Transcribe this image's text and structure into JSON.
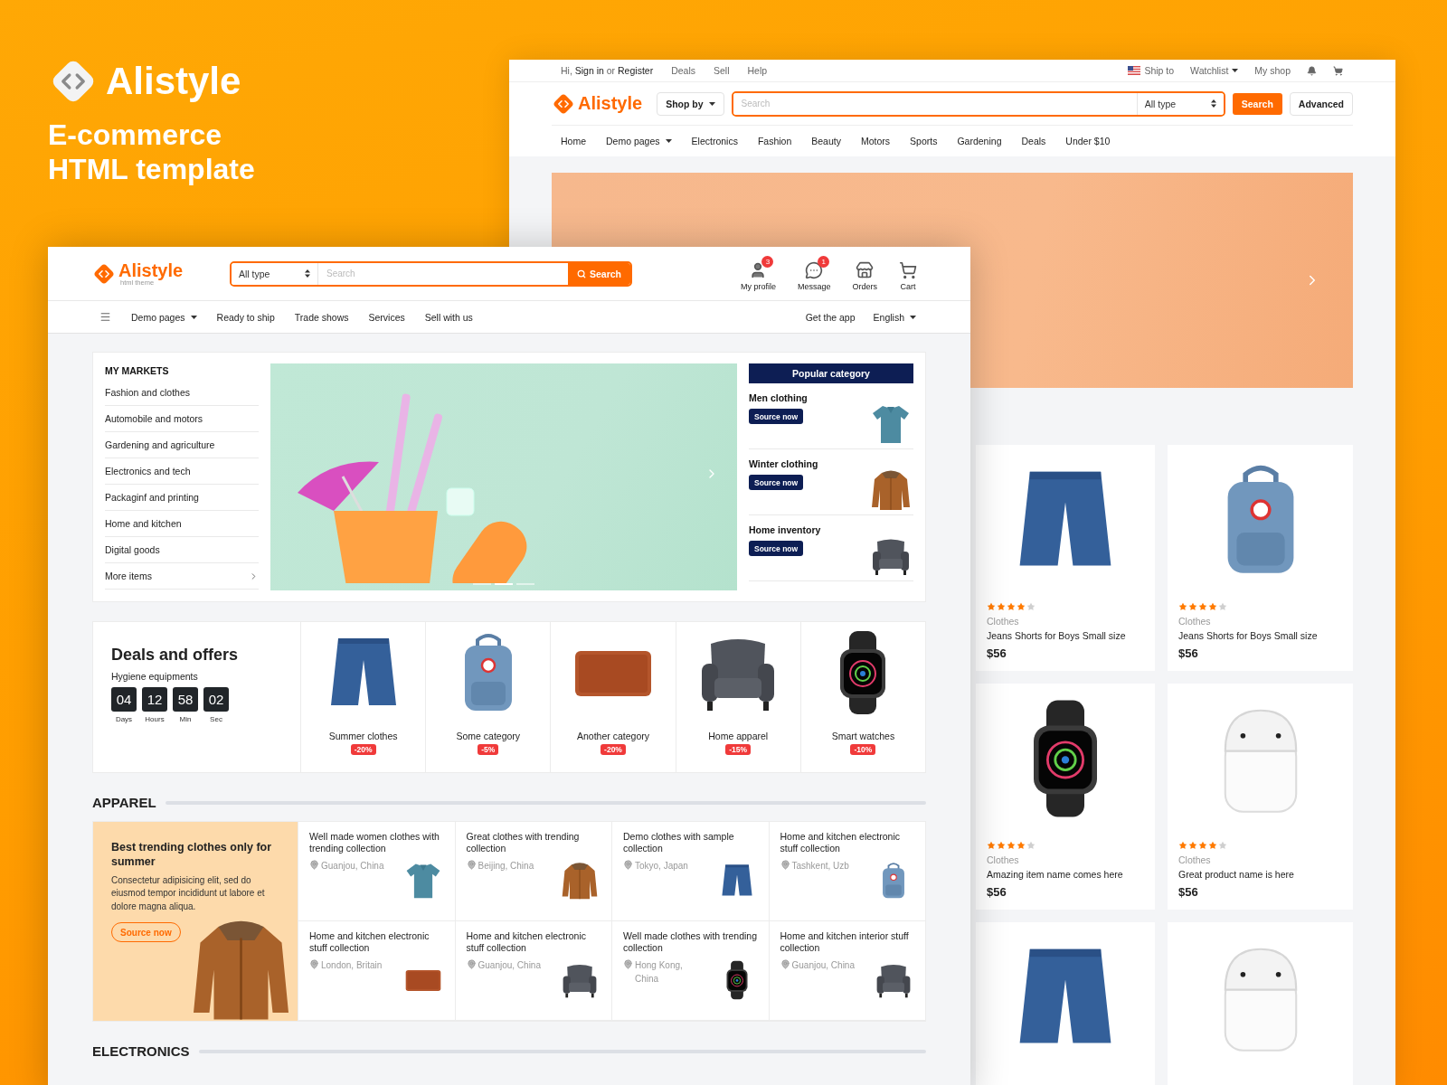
{
  "promo": {
    "brand": "Alistyle",
    "headline": "E-commerce HTML template"
  },
  "back_window": {
    "top_bar": {
      "greeting": "Hi, **Sign in** or **Register**",
      "links": [
        "Deals",
        "Sell",
        "Help"
      ],
      "ship_to": "Ship to",
      "watchlist": "Watchlist",
      "my_shop": "My shop"
    },
    "header": {
      "brand": "Alistyle",
      "shop_by": "Shop by",
      "search": {
        "placeholder": "Search"
      },
      "type_select": "All type",
      "search_button": "Search",
      "advanced_button": "Advanced"
    },
    "nav": [
      {
        "label": "Home",
        "dropdown": false
      },
      {
        "label": "Demo pages",
        "dropdown": true
      },
      {
        "label": "Electronics",
        "dropdown": false
      },
      {
        "label": "Fashion",
        "dropdown": false
      },
      {
        "label": "Beauty",
        "dropdown": false
      },
      {
        "label": "Motors",
        "dropdown": false
      },
      {
        "label": "Sports",
        "dropdown": false
      },
      {
        "label": "Gardening",
        "dropdown": false
      },
      {
        "label": "Deals",
        "dropdown": false
      },
      {
        "label": "Under $10",
        "dropdown": false
      }
    ],
    "products": [
      {
        "kind": "shorts",
        "stars": 4,
        "category": "Clothes",
        "name": "Jeans Shorts for Boys Small size",
        "price": "$56"
      },
      {
        "kind": "backpack",
        "stars": 4,
        "category": "Clothes",
        "name": "Jeans Shorts for Boys Small size",
        "price": "$56"
      },
      {
        "kind": "watch",
        "stars": 4,
        "category": "Clothes",
        "name": "Amazing item name comes here",
        "price": "$56"
      },
      {
        "kind": "airpods",
        "stars": 4,
        "category": "Clothes",
        "name": "Great product name is here",
        "price": "$56"
      },
      {
        "kind": "shorts"
      },
      {
        "kind": "airpods"
      }
    ]
  },
  "front_window": {
    "header": {
      "brand": "Alistyle",
      "tagline": "html theme",
      "type_select": "All type",
      "search": {
        "placeholder": "Search"
      },
      "search_button": "Search",
      "actions": [
        {
          "kind": "profile",
          "label": "My profile",
          "badge": "3"
        },
        {
          "kind": "message",
          "label": "Message",
          "badge": "1"
        },
        {
          "kind": "orders",
          "label": "Orders"
        },
        {
          "kind": "cart",
          "label": "Cart"
        }
      ]
    },
    "nav": {
      "left": [
        {
          "label": "Demo pages",
          "dropdown": true
        },
        {
          "label": "Ready to ship",
          "dropdown": false
        },
        {
          "label": "Trade shows",
          "dropdown": false
        },
        {
          "label": "Services",
          "dropdown": false
        },
        {
          "label": "Sell with us",
          "dropdown": false
        }
      ],
      "right": [
        {
          "label": "Get the app",
          "dropdown": false
        },
        {
          "label": "English",
          "dropdown": true
        }
      ]
    },
    "markets": {
      "title": "MY MARKETS",
      "items": [
        {
          "label": "Fashion and clothes",
          "chevron": false
        },
        {
          "label": "Automobile and motors",
          "chevron": false
        },
        {
          "label": "Gardening and agriculture",
          "chevron": false
        },
        {
          "label": "Electronics and tech",
          "chevron": false
        },
        {
          "label": "Packaginf and printing",
          "chevron": false
        },
        {
          "label": "Home and kitchen",
          "chevron": false
        },
        {
          "label": "Digital goods",
          "chevron": false
        },
        {
          "label": "More items",
          "chevron": true
        }
      ]
    },
    "banner": {
      "slides": [
        {
          "selected": false
        },
        {
          "selected": true
        },
        {
          "selected": false
        }
      ]
    },
    "popular": {
      "title": "Popular category",
      "items": [
        {
          "kind": "polo",
          "name": "Men clothing",
          "button": "Source now"
        },
        {
          "kind": "jacket",
          "name": "Winter clothing",
          "button": "Source now"
        },
        {
          "kind": "armchair",
          "name": "Home inventory",
          "button": "Source now"
        }
      ]
    },
    "deals": {
      "title": "Deals and offers",
      "subtitle": "Hygiene equipments",
      "countdown": [
        {
          "value": "04",
          "unit": "Days"
        },
        {
          "value": "12",
          "unit": "Hours"
        },
        {
          "value": "58",
          "unit": "Min"
        },
        {
          "value": "02",
          "unit": "Sec"
        }
      ],
      "items": [
        {
          "kind": "shorts",
          "name": "Summer clothes",
          "discount": "-20%"
        },
        {
          "kind": "backpack",
          "name": "Some category",
          "discount": "-5%"
        },
        {
          "kind": "sleeve",
          "name": "Another category",
          "discount": "-20%"
        },
        {
          "kind": "armchair",
          "name": "Home apparel",
          "discount": "-15%"
        },
        {
          "kind": "watch",
          "name": "Smart watches",
          "discount": "-10%"
        }
      ]
    },
    "apparel": {
      "title": "APPAREL",
      "promo": {
        "title": "Best trending clothes only for summer",
        "text": "Consectetur adipisicing elit, sed do eiusmod tempor incididunt ut labore et dolore magna aliqua.",
        "button": "Source now"
      },
      "items": [
        {
          "kind": "polo",
          "name": "Well made women clothes with trending collection",
          "location": "Guanjou, China"
        },
        {
          "kind": "jacket",
          "name": "Great clothes with trending collection",
          "location": "Beijing, China"
        },
        {
          "kind": "shorts",
          "name": "Demo clothes with sample collection",
          "location": "Tokyo, Japan"
        },
        {
          "kind": "backpack",
          "name": "Home and kitchen electronic stuff collection",
          "location": "Tashkent, Uzb"
        },
        {
          "kind": "sleeve",
          "name": "Home and kitchen electronic stuff collection",
          "location": "London, Britain"
        },
        {
          "kind": "armchair",
          "name": "Home and kitchen electronic stuff collection",
          "location": "Guanjou, China"
        },
        {
          "kind": "watch",
          "name": "Well made clothes with trending collection",
          "location": "Hong Kong, China"
        },
        {
          "kind": "armchair",
          "name": "Home and kitchen interior stuff collection",
          "location": "Guanjou, China"
        }
      ]
    },
    "electronics": {
      "title": "ELECTRONICS"
    }
  }
}
